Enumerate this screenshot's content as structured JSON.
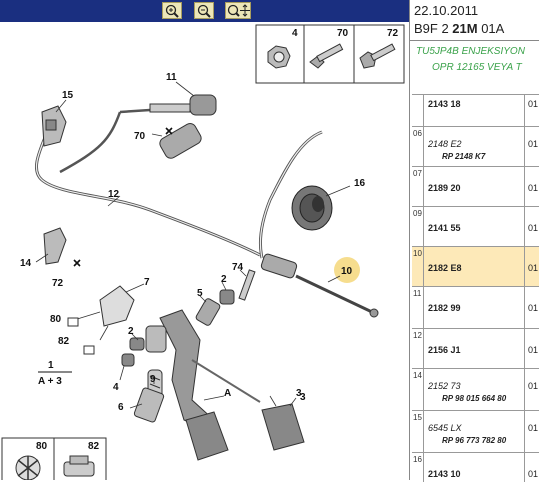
{
  "toolbar": {
    "buttons": [
      {
        "name": "zoom-in-icon"
      },
      {
        "name": "zoom-out-icon"
      },
      {
        "name": "zoom-pan-icon"
      }
    ]
  },
  "header": {
    "date": "22.10.2011",
    "code_prefix": "B9F 2 ",
    "code_bold": "21M",
    "code_suffix": " 01A",
    "desc_line1": "TU5JP4B ENJEKSIYON",
    "desc_line2": "OPR 12165 VEYA T"
  },
  "diagram": {
    "insets_top": [
      "4",
      "70",
      "72"
    ],
    "insets_bottom": [
      "80",
      "82"
    ],
    "callouts": [
      "15",
      "11",
      "70",
      "12",
      "16",
      "14",
      "72",
      "10",
      "7",
      "74",
      "2",
      "5",
      "80",
      "2",
      "3",
      "82",
      "9",
      "4",
      "1",
      "A + 3",
      "6",
      "A",
      "3"
    ]
  },
  "parts": [
    {
      "no": "",
      "ref": "2143 18",
      "sub": "",
      "qty": "01",
      "ital": false
    },
    {
      "no": "06",
      "ref": "2148 E2",
      "sub": "RP 2148 K7",
      "qty": "01",
      "ital": true
    },
    {
      "no": "07",
      "ref": "2189 20",
      "sub": "",
      "qty": "01",
      "ital": false
    },
    {
      "no": "09",
      "ref": "2141 55",
      "sub": "",
      "qty": "01",
      "ital": false
    },
    {
      "no": "10",
      "ref": "2182 E8",
      "sub": "",
      "qty": "01",
      "ital": false
    },
    {
      "no": "11",
      "ref": "2182 99",
      "sub": "",
      "qty": "01",
      "ital": false
    },
    {
      "no": "12",
      "ref": "2156 J1",
      "sub": "",
      "qty": "01",
      "ital": false
    },
    {
      "no": "14",
      "ref": "2152 73",
      "sub": "RP 98 015 664 80",
      "qty": "01",
      "ital": true
    },
    {
      "no": "15",
      "ref": "6545 LX",
      "sub": "RP 96 773 782 80",
      "qty": "01",
      "ital": true
    },
    {
      "no": "16",
      "ref": "2143 10",
      "sub": "",
      "qty": "01",
      "ital": false
    }
  ],
  "selected_no": "10"
}
